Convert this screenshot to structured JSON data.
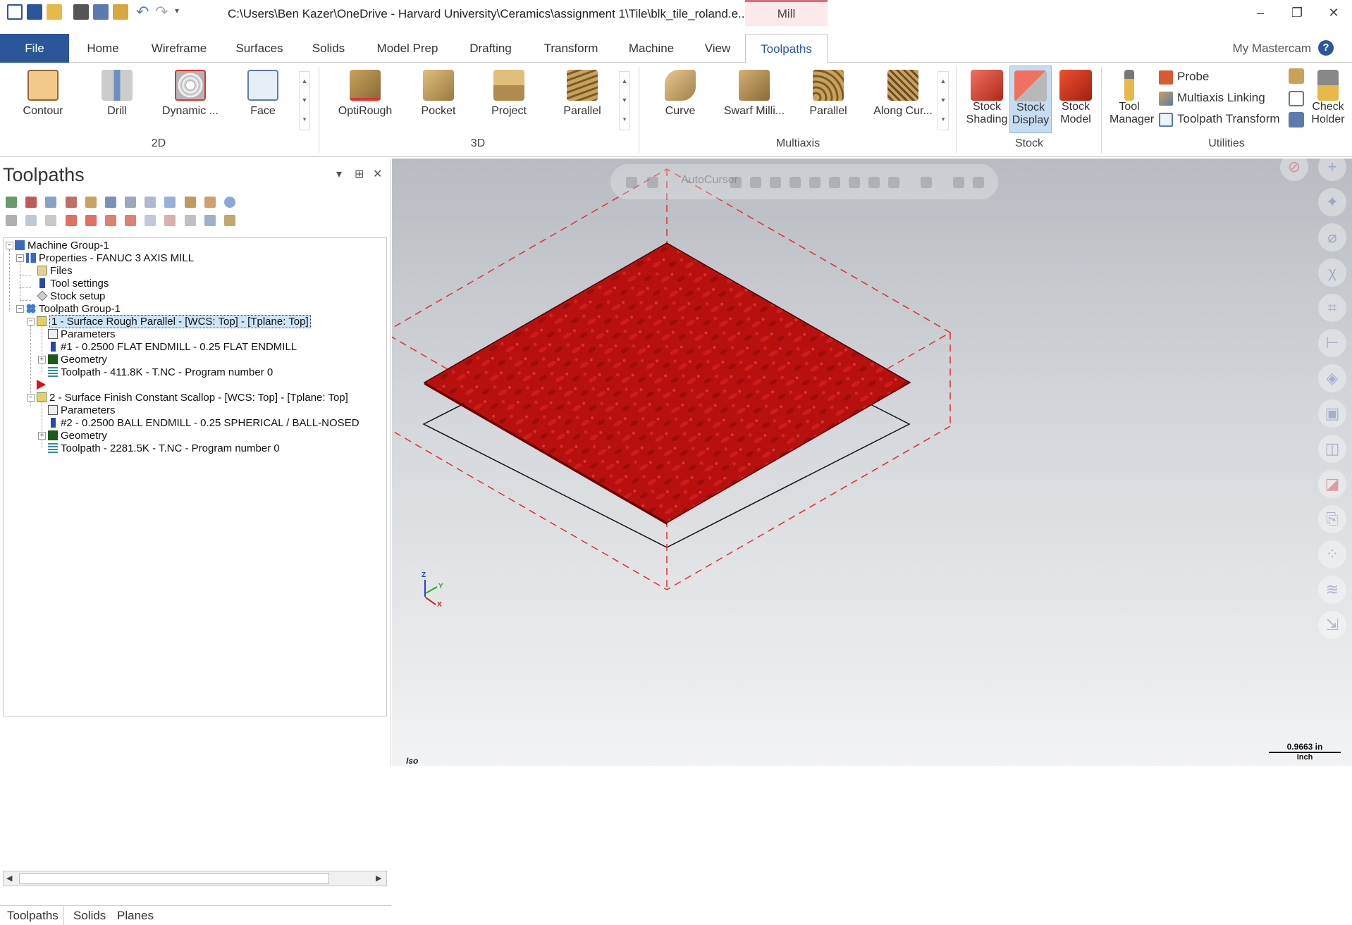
{
  "title_bar": {
    "path": "C:\\Users\\Ben Kazer\\OneDrive - Harvard University\\Ceramics\\assignment 1\\Tile\\blk_tile_roland.e...",
    "context_tab": "Mill",
    "minimize": "–",
    "maximize": "❐",
    "close": "✕"
  },
  "ribbon_tabs": {
    "file": "File",
    "tabs": [
      "Home",
      "Wireframe",
      "Surfaces",
      "Solids",
      "Model Prep",
      "Drafting",
      "Transform",
      "Machine",
      "View",
      "Toolpaths"
    ],
    "active": "Toolpaths",
    "my_mastercam": "My Mastercam",
    "help": "?"
  },
  "ribbon": {
    "group_2d": {
      "label": "2D",
      "buttons": [
        {
          "label": "Contour",
          "icon": "contour-icon"
        },
        {
          "label": "Drill",
          "icon": "drill-icon"
        },
        {
          "label": "Dynamic ...",
          "icon": "dynamic-icon"
        },
        {
          "label": "Face",
          "icon": "face-icon"
        }
      ]
    },
    "group_3d": {
      "label": "3D",
      "buttons": [
        {
          "label": "OptiRough",
          "icon": "optirough-icon"
        },
        {
          "label": "Pocket",
          "icon": "pocket-icon"
        },
        {
          "label": "Project",
          "icon": "project-icon"
        },
        {
          "label": "Parallel",
          "icon": "parallel-icon"
        }
      ]
    },
    "group_multiaxis": {
      "label": "Multiaxis",
      "buttons": [
        {
          "label": "Curve",
          "icon": "curve-icon"
        },
        {
          "label": "Swarf Milli...",
          "icon": "swarf-icon"
        },
        {
          "label": "Parallel",
          "icon": "parallel-multiaxis-icon"
        },
        {
          "label": "Along Cur...",
          "icon": "along-curve-icon"
        }
      ]
    },
    "group_stock": {
      "label": "Stock",
      "buttons": [
        {
          "line1": "Stock",
          "line2": "Shading",
          "icon": "stock-shading-icon"
        },
        {
          "line1": "Stock",
          "line2": "Display",
          "icon": "stock-display-icon"
        },
        {
          "line1": "Stock",
          "line2": "Model",
          "icon": "stock-model-icon"
        }
      ]
    },
    "group_utilities": {
      "label": "Utilities",
      "tool_manager": {
        "line1": "Tool",
        "line2": "Manager"
      },
      "probe": "Probe",
      "multiaxis_linking": "Multiaxis Linking",
      "toolpath_transform": "Toolpath Transform",
      "check_holder": {
        "line1": "Check",
        "line2": "Holder"
      }
    },
    "colors": {
      "accent": "#2b579a",
      "selected_bg": "#c5dcf2",
      "context_tab_bg": "#fbe9ec"
    }
  },
  "panel": {
    "title": "Toolpaths",
    "pin": "⊞",
    "dropdown": "▾",
    "close": "✕",
    "tree": {
      "machine_group": "Machine Group-1",
      "properties": "Properties - FANUC 3 AXIS MILL",
      "files": "Files",
      "tool_settings": "Tool settings",
      "stock_setup": "Stock setup",
      "toolpath_group": "Toolpath Group-1",
      "op1": "1 - Surface Rough Parallel - [WCS: Top] - [Tplane: Top]",
      "op1_parameters": "Parameters",
      "op1_tool": "#1 - 0.2500 FLAT ENDMILL - 0.25 FLAT ENDMILL",
      "op1_geometry": "Geometry",
      "op1_toolpath": "Toolpath - 411.8K - T.NC - Program number 0",
      "op2": "2 - Surface Finish Constant Scallop - [WCS: Top] - [Tplane: Top]",
      "op2_parameters": "Parameters",
      "op2_tool": "#2 - 0.2500 BALL ENDMILL - 0.25 SPHERICAL / BALL-NOSED",
      "op2_geometry": "Geometry",
      "op2_toolpath": "Toolpath - 2281.5K - T.NC - Program number 0"
    },
    "bottom_tabs": [
      "Toolpaths",
      "Solids",
      "Planes"
    ]
  },
  "viewport": {
    "autocursor": "AutoCursor",
    "view_label": "Iso",
    "scale_value": "0.9663 in",
    "scale_unit": "Inch",
    "axis_z": "Z",
    "axis_y": "Y",
    "axis_x": "X",
    "stock_color": "#b01010",
    "bounds_color": "#e03030"
  }
}
